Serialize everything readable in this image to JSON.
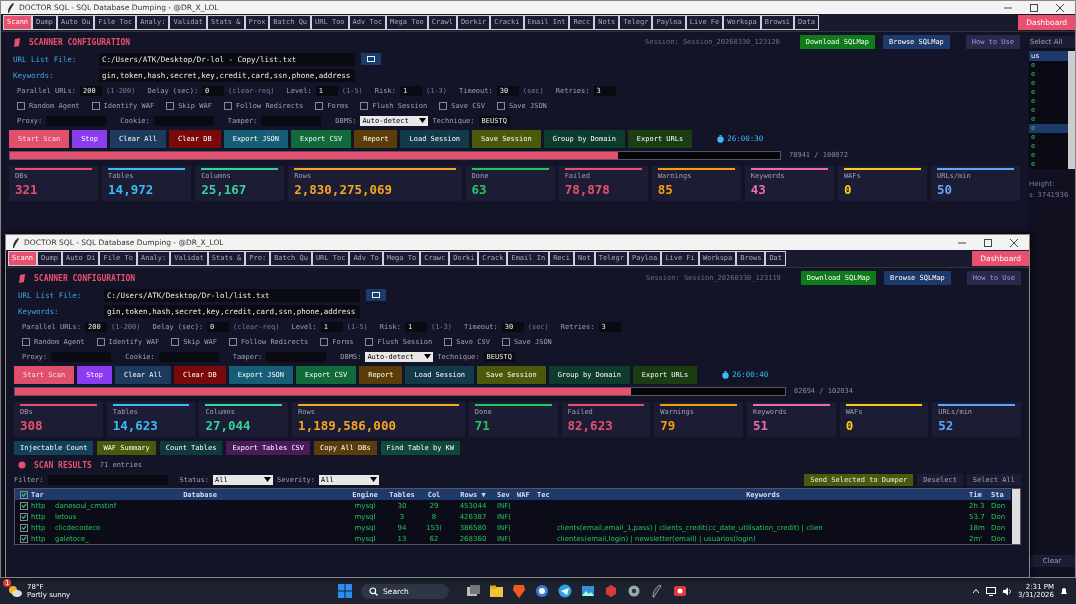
{
  "windows": [
    {
      "title": "DOCTOR SQL - SQL Database Dumping - @DR_X_LOL",
      "window_buttons": true,
      "tabs": [
        {
          "label": "Scann",
          "selected": true
        },
        {
          "label": "Dump",
          "selected": false
        },
        {
          "label": "Auto Du",
          "selected": false
        },
        {
          "label": "File Toc",
          "selected": false
        },
        {
          "label": "Analy:",
          "selected": false
        },
        {
          "label": "Validat",
          "selected": false
        },
        {
          "label": "Stats &",
          "selected": false
        },
        {
          "label": "Prox",
          "selected": false
        },
        {
          "label": "Batch Qu",
          "selected": false
        },
        {
          "label": "URL Too",
          "selected": false
        },
        {
          "label": "Adv Toc",
          "selected": false
        },
        {
          "label": "Mega Too",
          "selected": false
        },
        {
          "label": "Crawl",
          "selected": false
        },
        {
          "label": "Dorkir",
          "selected": false
        },
        {
          "label": "Cracki",
          "selected": false
        },
        {
          "label": "Email Int",
          "selected": false
        },
        {
          "label": "Recc",
          "selected": false
        },
        {
          "label": "Nots",
          "selected": false
        },
        {
          "label": "Telegr",
          "selected": false
        },
        {
          "label": "Payloa",
          "selected": false
        },
        {
          "label": "Live Fe",
          "selected": false
        },
        {
          "label": "Workspa",
          "selected": false
        },
        {
          "label": "Browsi",
          "selected": false
        },
        {
          "label": "Data",
          "selected": false
        }
      ],
      "dashboard": "Dashboard",
      "config": {
        "heading": "SCANNER CONFIGURATION",
        "session": "Session: Session_20260330_123120",
        "top_buttons": [
          "Download SQLMap",
          "Browse SQLMap",
          "How to Use"
        ],
        "url_label": "URL List File:",
        "url_value": "C:/Users/ATK/Desktop/Dr-lol - Copy/list.txt",
        "keywords_label": "Keywords:",
        "keywords_value": "gin,token,hash,secret,key,credit,card,ssn,phone,address",
        "params": [
          {
            "label": "Parallel URLs:",
            "value": "200",
            "hint": "(1-200)"
          },
          {
            "label": "Delay (sec):",
            "value": "0",
            "hint": "(clear-req)"
          },
          {
            "label": "Level:",
            "value": "1",
            "hint": "(1-5)"
          },
          {
            "label": "Risk:",
            "value": "1",
            "hint": "(1-3)"
          },
          {
            "label": "Timeout:",
            "value": "30",
            "hint": "(sec)"
          },
          {
            "label": "Retries:",
            "value": "3"
          }
        ],
        "options": [
          {
            "label": "Random Agent",
            "checked": false
          },
          {
            "label": "Identify WAF",
            "checked": false
          },
          {
            "label": "Skip WAF",
            "checked": false
          },
          {
            "label": "Follow Redirects",
            "checked": false
          },
          {
            "label": "Forms",
            "checked": false
          },
          {
            "label": "Flush Session",
            "checked": false
          },
          {
            "label": "Save CSV",
            "checked": false
          },
          {
            "label": "Save JSON",
            "checked": false
          }
        ],
        "fields": [
          {
            "label": "Proxy:"
          },
          {
            "label": "Cookie:"
          },
          {
            "label": "Tamper:"
          }
        ],
        "dbms_label": "DBMS:",
        "dbms_value": "Auto-detect",
        "technique_label": "Technique:",
        "technique_value": "BEUSTQ"
      },
      "actions": [
        {
          "label": "Start Scan",
          "color": "#e0506a",
          "disabled": true
        },
        {
          "label": "Stop",
          "color": "#8b3cf0",
          "disabled": false
        },
        {
          "label": "Clear All",
          "color": "#1d3a5f",
          "disabled": false
        },
        {
          "label": "Clear DB",
          "color": "#7a0a0a",
          "disabled": false
        },
        {
          "label": "Export JSON",
          "color": "#155e75",
          "disabled": false
        },
        {
          "label": "Export CSV",
          "color": "#116a3a",
          "disabled": false
        },
        {
          "label": "Report",
          "color": "#5c3d0a",
          "disabled": false
        },
        {
          "label": "Load Session",
          "color": "#123a4a",
          "disabled": false
        },
        {
          "label": "Save Session",
          "color": "#4a5a0a",
          "disabled": false
        },
        {
          "label": "Group by Domain",
          "color": "#0d3b2e",
          "disabled": false
        },
        {
          "label": "Export URLs",
          "color": "#1a3d12",
          "disabled": false
        }
      ],
      "timer": "26:00:30",
      "progress": {
        "level": 0.79,
        "reading": "78941 / 100072"
      },
      "stats": [
        {
          "label": "DBs",
          "value": "321",
          "color": "#e8506f"
        },
        {
          "label": "Tables",
          "value": "14,972",
          "color": "#38bdf8"
        },
        {
          "label": "Columns",
          "value": "25,167",
          "color": "#34d399"
        },
        {
          "label": "Rows",
          "value": "2,830,275,069",
          "color": "#f5a524"
        },
        {
          "label": "Done",
          "value": "63",
          "color": "#22c55e"
        },
        {
          "label": "Failed",
          "value": "78,878",
          "color": "#e8506f"
        },
        {
          "label": "Warnings",
          "value": "85",
          "color": "#f59e0b"
        },
        {
          "label": "Keywords",
          "value": "43",
          "color": "#ec6bb0"
        },
        {
          "label": "WAFs",
          "value": "0",
          "color": "#facc15"
        },
        {
          "label": "URLs/min",
          "value": "50",
          "color": "#60a5fa"
        }
      ],
      "side_panel": {
        "button": "Select All",
        "header": "us",
        "rows": [
          {
            "text": "e",
            "selected": false
          },
          {
            "text": "e",
            "selected": false
          },
          {
            "text": "e",
            "selected": false
          },
          {
            "text": "e",
            "selected": false
          },
          {
            "text": "e",
            "selected": false
          },
          {
            "text": "e",
            "selected": false
          },
          {
            "text": "e",
            "selected": false
          },
          {
            "text": "e",
            "selected": true
          },
          {
            "text": "e",
            "selected": false
          },
          {
            "text": "e",
            "selected": false
          },
          {
            "text": "e",
            "selected": false
          },
          {
            "text": "e",
            "selected": false
          }
        ],
        "label": "Height:",
        "count": "s: 3741936",
        "clear": "Clear"
      }
    },
    {
      "title": "DOCTOR SQL - SQL Database Dumping - @DR_X_LOL",
      "window_buttons": true,
      "tabs": [
        {
          "label": "Scann",
          "selected": true
        },
        {
          "label": "Dump",
          "selected": false
        },
        {
          "label": "Auto Di",
          "selected": false
        },
        {
          "label": "File To",
          "selected": false
        },
        {
          "label": "Analy:",
          "selected": false
        },
        {
          "label": "Validat",
          "selected": false
        },
        {
          "label": "Stats &",
          "selected": false
        },
        {
          "label": "Pro:",
          "selected": false
        },
        {
          "label": "Batch Qu",
          "selected": false
        },
        {
          "label": "URL Toc",
          "selected": false
        },
        {
          "label": "Adv To",
          "selected": false
        },
        {
          "label": "Mega To",
          "selected": false
        },
        {
          "label": "Crawc",
          "selected": false
        },
        {
          "label": "Dorki",
          "selected": false
        },
        {
          "label": "Crack",
          "selected": false
        },
        {
          "label": "Email In",
          "selected": false
        },
        {
          "label": "Reci",
          "selected": false
        },
        {
          "label": "Not",
          "selected": false
        },
        {
          "label": "Telegr",
          "selected": false
        },
        {
          "label": "Payloa",
          "selected": false
        },
        {
          "label": "Live Fi",
          "selected": false
        },
        {
          "label": "Workspa",
          "selected": false
        },
        {
          "label": "Brows",
          "selected": false
        },
        {
          "label": "Dat",
          "selected": false
        }
      ],
      "dashboard": "Dashboard",
      "config": {
        "heading": "SCANNER CONFIGURATION",
        "session": "Session: Session_20260330_123119",
        "top_buttons": [
          "Download SQLMap",
          "Browse SQLMap",
          "How to Use"
        ],
        "url_label": "URL List File:",
        "url_value": "C:/Users/ATK/Desktop/Dr-lol/list.txt",
        "keywords_label": "Keywords:",
        "keywords_value": "gin,token,hash,secret,key,credit,card,ssn,phone,address",
        "params": [
          {
            "label": "Parallel URLs:",
            "value": "200",
            "hint": "(1-200)"
          },
          {
            "label": "Delay (sec):",
            "value": "0",
            "hint": "(clear-req)"
          },
          {
            "label": "Level:",
            "value": "1",
            "hint": "(1-5)"
          },
          {
            "label": "Risk:",
            "value": "1",
            "hint": "(1-3)"
          },
          {
            "label": "Timeout:",
            "value": "30",
            "hint": "(sec)"
          },
          {
            "label": "Retries:",
            "value": "3"
          }
        ],
        "options": [
          {
            "label": "Random Agent",
            "checked": false
          },
          {
            "label": "Identify WAF",
            "checked": false
          },
          {
            "label": "Skip WAF",
            "checked": false
          },
          {
            "label": "Follow Redirects",
            "checked": false
          },
          {
            "label": "Forms",
            "checked": false
          },
          {
            "label": "Flush Session",
            "checked": false
          },
          {
            "label": "Save CSV",
            "checked": false
          },
          {
            "label": "Save JSON",
            "checked": false
          }
        ],
        "fields": [
          {
            "label": "Proxy:"
          },
          {
            "label": "Cookie:"
          },
          {
            "label": "Tamper:"
          }
        ],
        "dbms_label": "DBMS:",
        "dbms_value": "Auto-detect",
        "technique_label": "Technique:",
        "technique_value": "BEUSTQ"
      },
      "actions": [
        {
          "label": "Start Scan",
          "color": "#e0506a",
          "disabled": true
        },
        {
          "label": "Stop",
          "color": "#8b3cf0",
          "disabled": false
        },
        {
          "label": "Clear All",
          "color": "#1d3a5f",
          "disabled": false
        },
        {
          "label": "Clear DB",
          "color": "#7a0a0a",
          "disabled": false
        },
        {
          "label": "Export JSON",
          "color": "#155e75",
          "disabled": false
        },
        {
          "label": "Export CSV",
          "color": "#116a3a",
          "disabled": false
        },
        {
          "label": "Report",
          "color": "#5c3d0a",
          "disabled": false
        },
        {
          "label": "Load Session",
          "color": "#123a4a",
          "disabled": false
        },
        {
          "label": "Save Session",
          "color": "#4a5a0a",
          "disabled": false
        },
        {
          "label": "Group by Domain",
          "color": "#0d3b2e",
          "disabled": false
        },
        {
          "label": "Export URLs",
          "color": "#1a3d12",
          "disabled": false
        }
      ],
      "timer": "26:00:40",
      "progress": {
        "level": 0.8,
        "reading": "82694 / 102834"
      },
      "stats": [
        {
          "label": "DBs",
          "value": "308",
          "color": "#e8506f"
        },
        {
          "label": "Tables",
          "value": "14,623",
          "color": "#38bdf8"
        },
        {
          "label": "Columns",
          "value": "27,044",
          "color": "#34d399"
        },
        {
          "label": "Rows",
          "value": "1,189,586,000",
          "color": "#f5a524"
        },
        {
          "label": "Done",
          "value": "71",
          "color": "#22c55e"
        },
        {
          "label": "Failed",
          "value": "82,623",
          "color": "#e8506f"
        },
        {
          "label": "Warnings",
          "value": "79",
          "color": "#f59e0b"
        },
        {
          "label": "Keywords",
          "value": "51",
          "color": "#ec6bb0"
        },
        {
          "label": "WAFs",
          "value": "0",
          "color": "#facc15"
        },
        {
          "label": "URLs/min",
          "value": "52",
          "color": "#60a5fa"
        }
      ],
      "table_tools": [
        {
          "label": "Injectable Count",
          "color": "#13405a"
        },
        {
          "label": "WAF Summary",
          "color": "#4a5a0a"
        },
        {
          "label": "Count Tables",
          "color": "#0d3b3b"
        },
        {
          "label": "Export Tables CSV",
          "color": "#4a1a5a"
        },
        {
          "label": "Copy All DBs",
          "color": "#5a3d0a"
        },
        {
          "label": "Find Table by KW",
          "color": "#0d4a3a"
        }
      ],
      "results": {
        "all_checked": true,
        "heading": "SCAN RESULTS",
        "count": "71 entries",
        "filter_label": "Filter:",
        "status_label": "Status:",
        "status_value": "All",
        "severity_label": "Severity:",
        "severity_value": "All",
        "buttons": [
          "Send Selected to Dumper",
          "Deselect",
          "Select All"
        ],
        "columns": [
          "Tar",
          "Database",
          "Engine",
          "Tables",
          "Col",
          "Rows ▼",
          "Sev",
          "WAF",
          "Tec",
          "Keywords",
          "Tim",
          "Sta"
        ],
        "rows": [
          {
            "checked": true,
            "cells": [
              "http",
              "danesoul_cmstinf",
              "mysql",
              "30",
              "29",
              "453044",
              "INF(",
              "",
              "",
              "",
              "2h 3",
              "Don"
            ]
          },
          {
            "checked": true,
            "cells": [
              "http",
              "letous",
              "mysql",
              "3",
              "8",
              "426387",
              "INF(",
              "",
              "",
              "",
              "53.7",
              "Don"
            ]
          },
          {
            "checked": true,
            "cells": [
              "http",
              "clicdecodeco",
              "mysql",
              "94",
              "153(",
              "386580",
              "INF(",
              "",
              "",
              "clients(email,email_1,pass) | clients_credit(cc_date_utilisation_credit) | clien",
              "18m",
              "Don"
            ]
          },
          {
            "checked": true,
            "cells": [
              "http",
              "galetoce_",
              "mysql",
              "13",
              "62",
              "268360",
              "INF(",
              "",
              "",
              "clientes(email,login) | newsletter(email) | usuarios(login)",
              "2m'",
              "Don"
            ]
          }
        ]
      }
    }
  ],
  "taskbar": {
    "temperature": "78°F",
    "weather": "Partly sunny",
    "badge": "1",
    "search": "Search",
    "time": "2:31 PM",
    "date": "3/31/2026"
  }
}
